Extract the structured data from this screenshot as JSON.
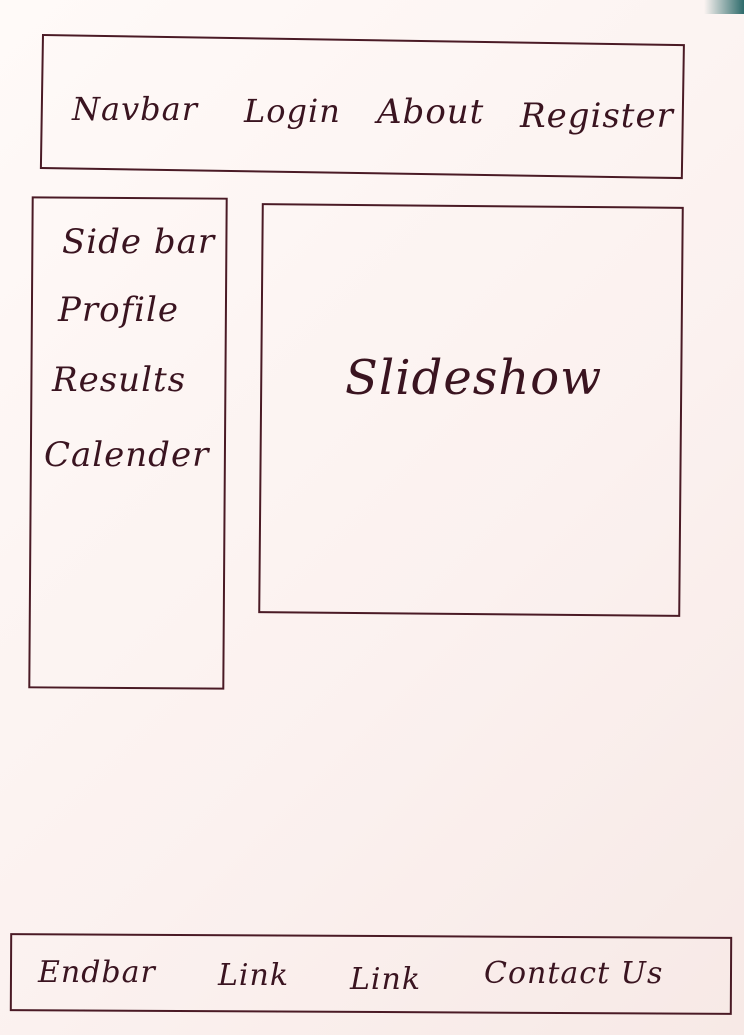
{
  "navbar": {
    "title": "Navbar",
    "items": [
      "Login",
      "About",
      "Register"
    ]
  },
  "sidebar": {
    "title": "Side bar",
    "items": [
      "Profile",
      "Results",
      "Calender"
    ]
  },
  "slideshow": {
    "label": "Slideshow"
  },
  "footer": {
    "title": "Endbar",
    "links": [
      "Link",
      "Link",
      "Contact Us"
    ]
  },
  "colors": {
    "ink": "#3a1420",
    "paper": "#fbf4f2"
  }
}
